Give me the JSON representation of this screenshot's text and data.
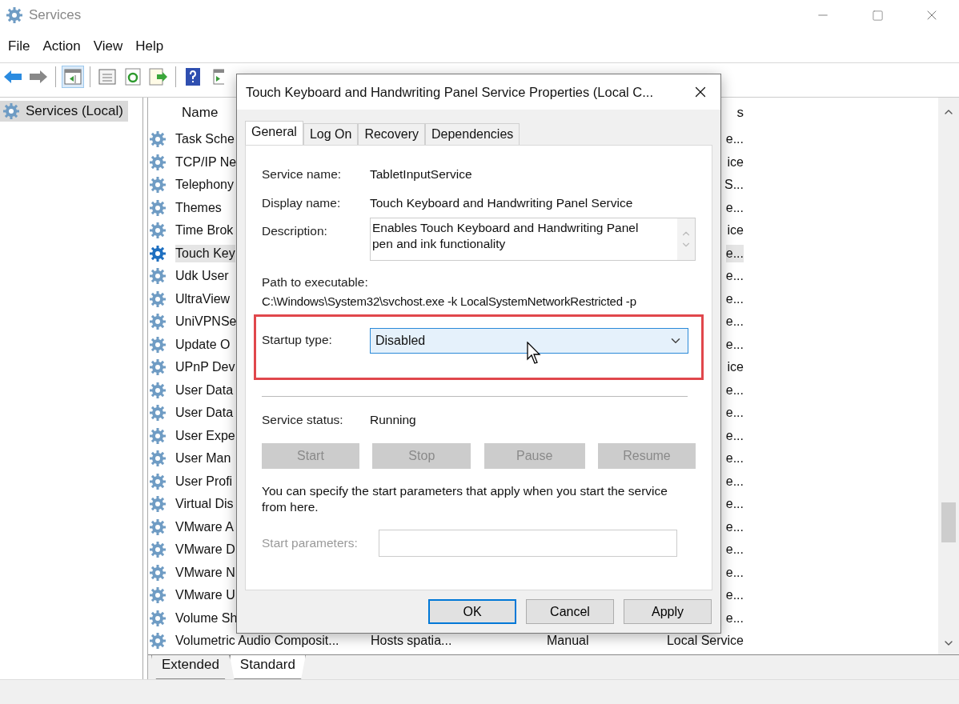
{
  "window": {
    "title": "Services"
  },
  "menu": [
    "File",
    "Action",
    "View",
    "Help"
  ],
  "toolbar": [
    {
      "kind": "back",
      "selected": false
    },
    {
      "kind": "forward",
      "selected": false
    },
    {
      "kind": "separator"
    },
    {
      "kind": "tree",
      "selected": true
    },
    {
      "kind": "separator"
    },
    {
      "kind": "properties",
      "selected": false
    },
    {
      "kind": "refresh",
      "selected": false
    },
    {
      "kind": "export",
      "selected": false
    },
    {
      "kind": "separator"
    },
    {
      "kind": "help",
      "selected": false
    },
    {
      "kind": "action",
      "selected": false
    }
  ],
  "tree": [
    {
      "label": "Services (Local)",
      "selected": true
    }
  ],
  "list": {
    "columns": [
      {
        "label": "Name"
      },
      {
        "label": "s"
      }
    ],
    "rows": [
      {
        "name": "Task Sche",
        "log_on_as": "e...",
        "selected": false
      },
      {
        "name": "TCP/IP Ne",
        "log_on_as": "ice",
        "selected": false
      },
      {
        "name": "Telephony",
        "log_on_as": "S...",
        "selected": false
      },
      {
        "name": "Themes",
        "log_on_as": "e...",
        "selected": false
      },
      {
        "name": "Time Brok",
        "log_on_as": "ice",
        "selected": false
      },
      {
        "name": "Touch Key",
        "log_on_as": "e...",
        "selected": true
      },
      {
        "name": "Udk User",
        "log_on_as": "e...",
        "selected": false
      },
      {
        "name": "UltraView",
        "log_on_as": "e...",
        "selected": false
      },
      {
        "name": "UniVPNSe",
        "log_on_as": "e...",
        "selected": false
      },
      {
        "name": "Update O",
        "log_on_as": "e...",
        "selected": false
      },
      {
        "name": "UPnP Dev",
        "log_on_as": "ice",
        "selected": false
      },
      {
        "name": "User Data",
        "log_on_as": "e...",
        "selected": false
      },
      {
        "name": "User Data",
        "log_on_as": "e...",
        "selected": false
      },
      {
        "name": "User Expe",
        "log_on_as": "e...",
        "selected": false
      },
      {
        "name": "User Man",
        "log_on_as": "e...",
        "selected": false
      },
      {
        "name": "User Profi",
        "log_on_as": "e...",
        "selected": false
      },
      {
        "name": "Virtual Dis",
        "log_on_as": "e...",
        "selected": false
      },
      {
        "name": "VMware A",
        "log_on_as": "e...",
        "selected": false
      },
      {
        "name": "VMware D",
        "log_on_as": "e...",
        "selected": false
      },
      {
        "name": "VMware N",
        "log_on_as": "e...",
        "selected": false
      },
      {
        "name": "VMware U",
        "log_on_as": "e...",
        "selected": false
      },
      {
        "name": "Volume Sh",
        "log_on_as": "e...",
        "selected": false
      },
      {
        "name": "Volumetric Audio Composit...",
        "description": "Hosts spatia...",
        "startup_type": "Manual",
        "log_on_as": "Local Service",
        "selected": false
      }
    ]
  },
  "view_tabs": [
    {
      "label": "Extended",
      "selected": false
    },
    {
      "label": "Standard",
      "selected": true
    }
  ],
  "dialog": {
    "title": "Touch Keyboard and Handwriting Panel Service Properties (Local C...",
    "tabs": [
      {
        "label": "General",
        "selected": true
      },
      {
        "label": "Log On",
        "selected": false
      },
      {
        "label": "Recovery",
        "selected": false
      },
      {
        "label": "Dependencies",
        "selected": false
      }
    ],
    "service_name": {
      "label": "Service name:",
      "value": "TabletInputService"
    },
    "display_name": {
      "label": "Display name:",
      "value": "Touch Keyboard and Handwriting Panel Service"
    },
    "description": {
      "label": "Description:",
      "value": "Enables Touch Keyboard and Handwriting Panel pen and ink functionality"
    },
    "path": {
      "label": "Path to executable:",
      "value": "C:\\Windows\\System32\\svchost.exe -k LocalSystemNetworkRestricted -p"
    },
    "startup_type": {
      "label": "Startup type:",
      "value": "Disabled",
      "highlighted": true
    },
    "service_status": {
      "label": "Service status:",
      "value": "Running"
    },
    "service_buttons": [
      {
        "label": "Start",
        "disabled": true
      },
      {
        "label": "Stop",
        "disabled": true
      },
      {
        "label": "Pause",
        "disabled": true
      },
      {
        "label": "Resume",
        "disabled": true
      }
    ],
    "hint": "You can specify the start parameters that apply when you start the service from here.",
    "start_parameters": {
      "label": "Start parameters:",
      "disabled": true
    },
    "buttons": [
      {
        "label": "OK",
        "default": true
      },
      {
        "label": "Cancel",
        "default": false
      },
      {
        "label": "Apply",
        "default": false
      }
    ]
  }
}
